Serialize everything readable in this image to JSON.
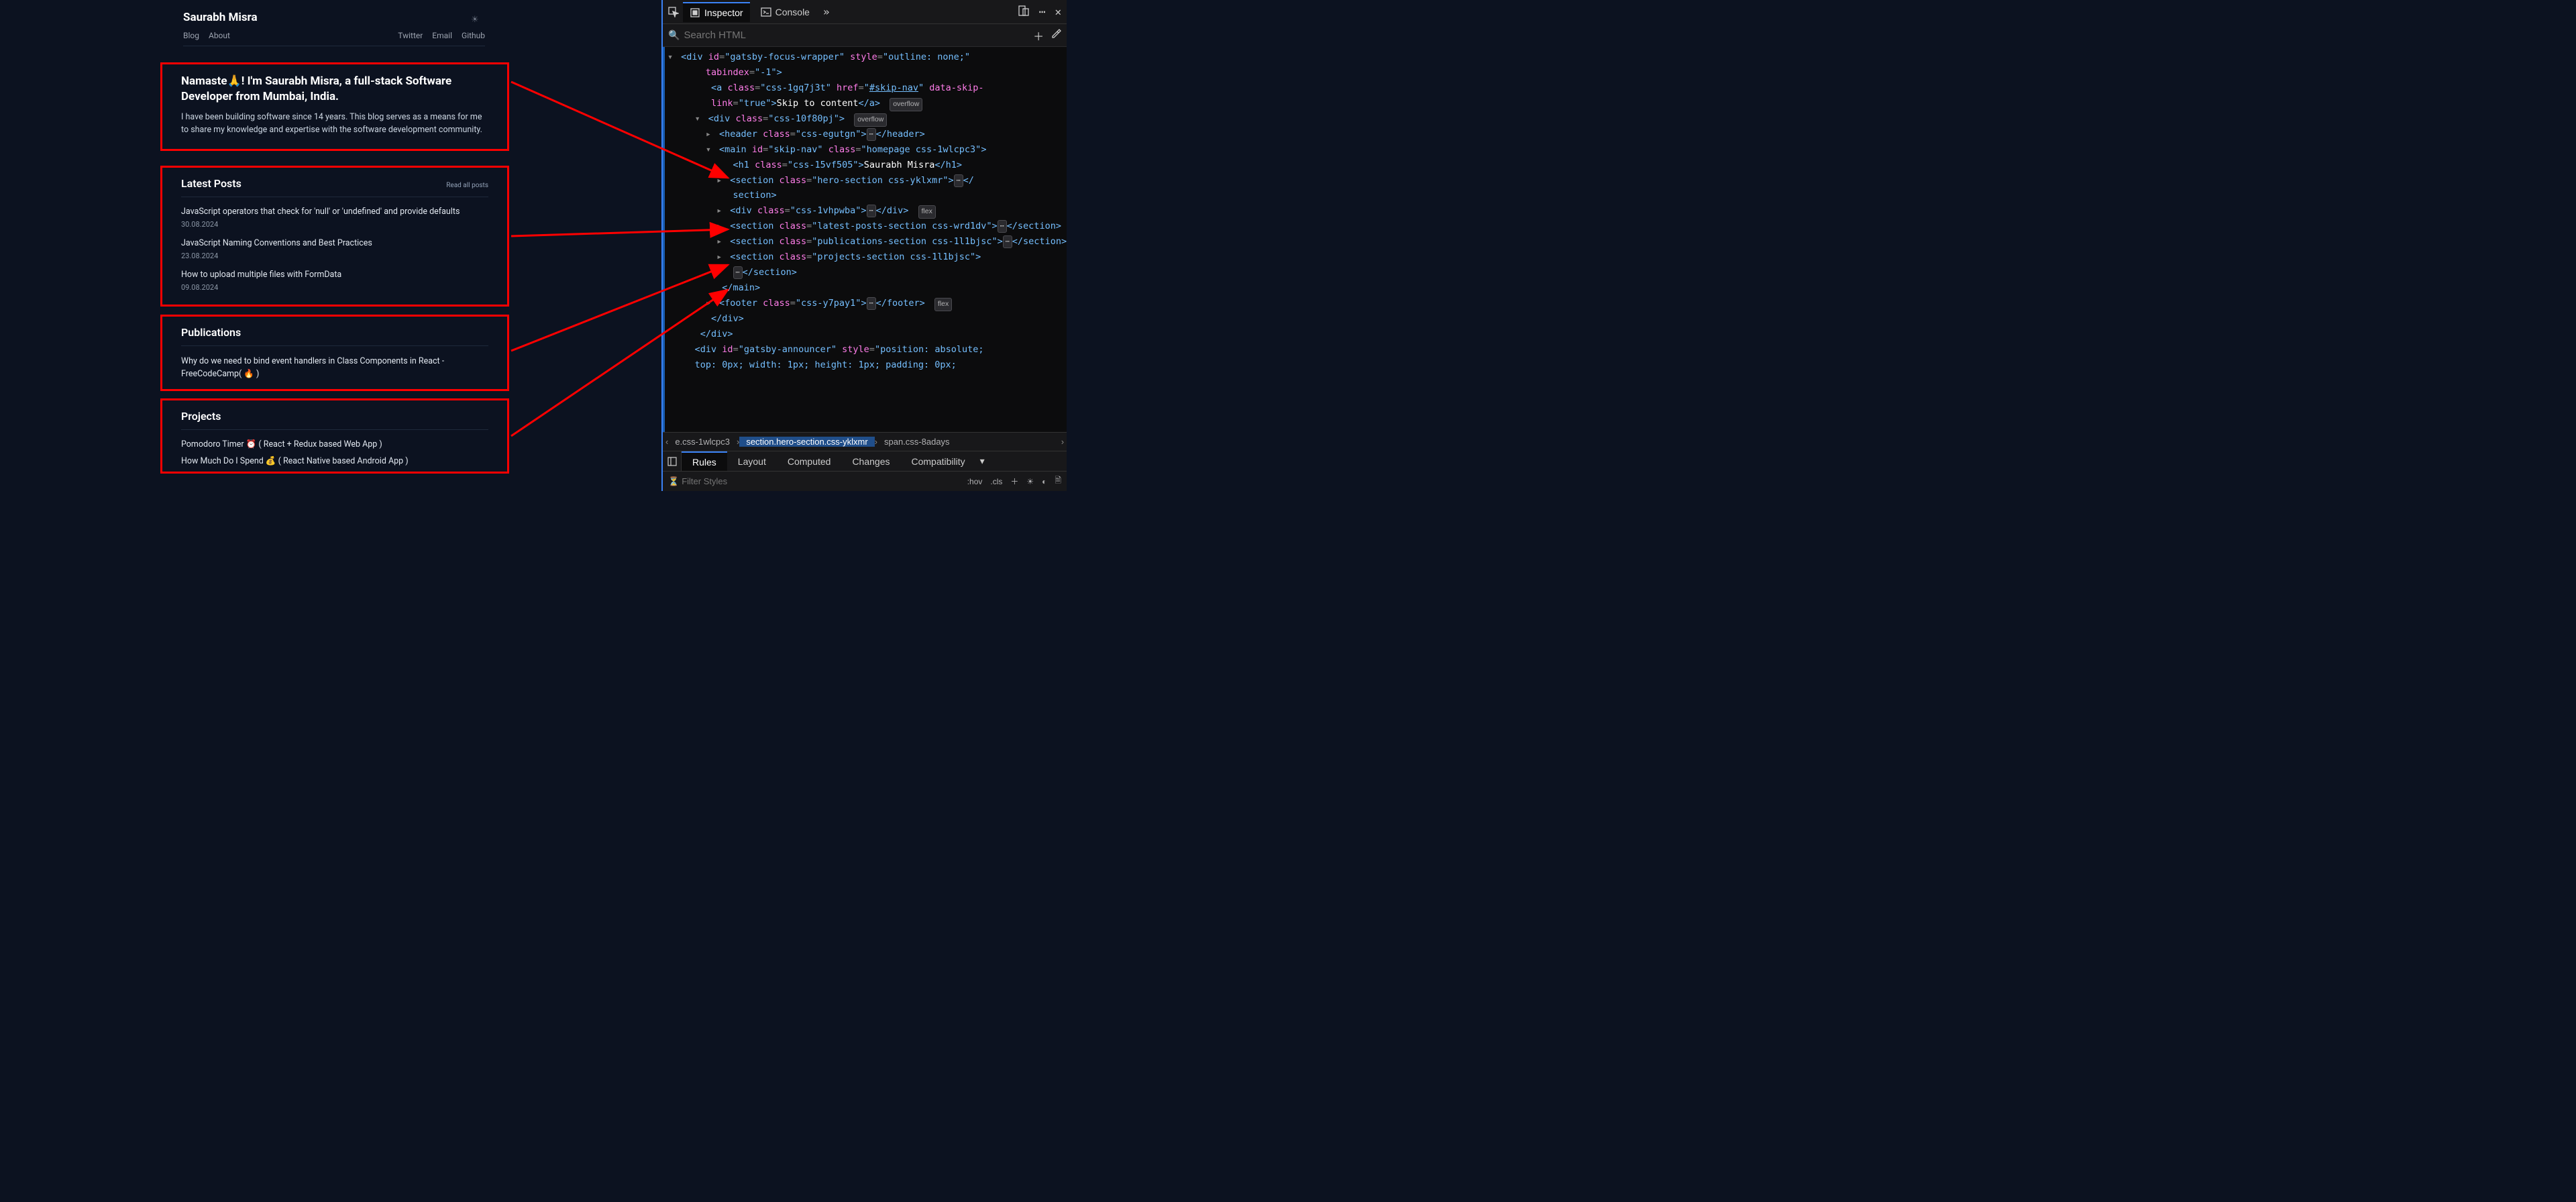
{
  "site": {
    "title": "Saurabh Misra",
    "nav_left": [
      "Blog",
      "About"
    ],
    "nav_right": [
      "Twitter",
      "Email",
      "Github"
    ],
    "hero": {
      "heading": "Namaste🙏! I'm Saurabh Misra, a full-stack Software Developer from Mumbai, India.",
      "body": "I have been building software since 14 years. This blog serves as a means for me to share my knowledge and expertise with the software development community."
    },
    "latest": {
      "heading": "Latest Posts",
      "read_all": "Read all posts",
      "posts": [
        {
          "title": "JavaScript operators that check for 'null' or 'undefined' and provide defaults",
          "date": "30.08.2024"
        },
        {
          "title": "JavaScript Naming Conventions and Best Practices",
          "date": "23.08.2024"
        },
        {
          "title": "How to upload multiple files with FormData",
          "date": "09.08.2024"
        }
      ]
    },
    "pubs": {
      "heading": "Publications",
      "items": [
        "Why do we need to bind event handlers in Class Components in React - FreeCodeCamp( 🔥 )"
      ]
    },
    "projects": {
      "heading": "Projects",
      "items": [
        "Pomodoro Timer ⏰ ( React + Redux based Web App )",
        "How Much Do I Spend 💰 ( React Native based Android App )"
      ]
    }
  },
  "devtools": {
    "tabs": {
      "inspector": "Inspector",
      "console": "Console"
    },
    "search_placeholder": "Search HTML",
    "breadcrumb": [
      "e.css-1wlcpc3",
      "section.hero-section.css-yklxmr",
      "span.css-8adays"
    ],
    "rules_tabs": [
      "Rules",
      "Layout",
      "Computed",
      "Changes",
      "Compatibility"
    ],
    "filter_placeholder": "Filter Styles",
    "hov": ":hov",
    "cls": ".cls",
    "dom": {
      "d0": "<div id=\"gatsby-focus-wrapper\" style=\"outline: none;\" tabindex=\"-1\">",
      "a_open": "<a class=\"",
      "a_cls": "css-1gq7j3t",
      "a_href": "\" href=\"",
      "a_href_v": "#skip-nav",
      "a_dsl": "\" data-skip-link=\"",
      "a_true": "true",
      "a_close": "\">",
      "a_txt": "Skip to content",
      "a_end": "</a>",
      "badge_overflow": "overflow",
      "badge_flex": "flex",
      "div_wrap_open": "<div class=\"",
      "div_wrap_cls": "css-10f80pj",
      "div_wrap_close": "\">",
      "header_open": "<header class=\"",
      "header_cls": "css-egutgn",
      "header_close": "\">",
      "header_end": "</header>",
      "main_open": "<main id=\"",
      "main_id": "skip-nav",
      "main_cls_lbl": "\" class=\"",
      "main_cls": "homepage css-1wlcpc3",
      "main_close": "\">",
      "h1_open": "<h1 class=\"",
      "h1_cls": "css-15vf505",
      "h1_close": "\">",
      "h1_txt": "Saurabh Misra",
      "h1_end": "</h1>",
      "sec_open": "<section class=\"",
      "sec_hero_cls": "hero-section css-yklxmr",
      "sec_close": "\">",
      "sec_end": "</section>",
      "div2_cls": "css-1vhpwba",
      "div_end": "</div>",
      "sec_latest_cls": "latest-posts-section css-wrd1dv",
      "sec_pubs_cls": "publications-section css-1l1bjsc",
      "sec_proj_cls": "projects-section css-1l1bjsc",
      "main_end": "</main>",
      "footer_open": "<footer class=\"",
      "footer_cls": "css-y7pay1",
      "footer_close": "\">",
      "footer_end": "</footer>",
      "announcer": "<div id=\"gatsby-announcer\" style=\"position: absolute; top: 0px; width: 1px; height: 1px; padding: 0px;"
    }
  }
}
